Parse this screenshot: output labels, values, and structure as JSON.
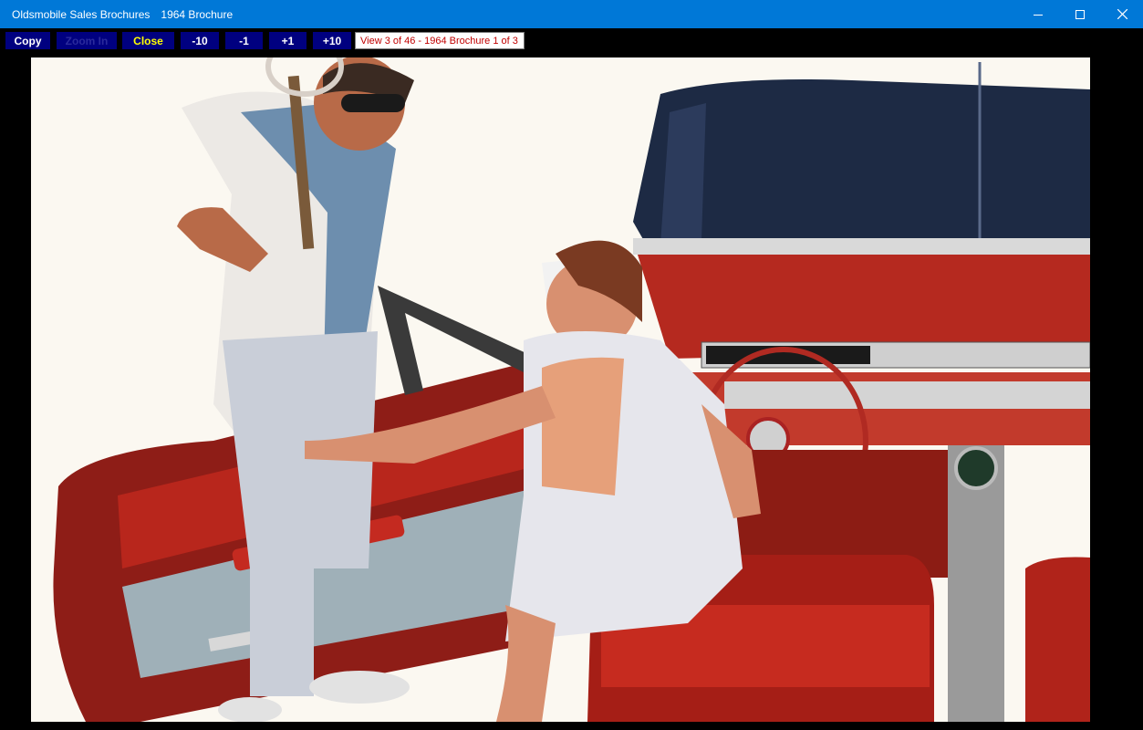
{
  "window": {
    "app_title": "Oldsmobile Sales Brochures",
    "doc_title": "1964 Brochure",
    "titlebar_color": "#0078d7"
  },
  "toolbar": {
    "buttons": [
      {
        "label": "Copy",
        "enabled": true
      },
      {
        "label": "Zoom In",
        "enabled": false
      },
      {
        "label": "Close",
        "enabled": true
      },
      {
        "label": "-10",
        "enabled": true
      },
      {
        "label": "-1",
        "enabled": true
      },
      {
        "label": "+1",
        "enabled": true
      },
      {
        "label": "+10",
        "enabled": true
      }
    ],
    "status": "View 3 of 46 - 1964 Brochure 1 of 3",
    "button_color": "#000080",
    "close_label_color": "#ffff00"
  },
  "image": {
    "subject": "illustration"
  }
}
